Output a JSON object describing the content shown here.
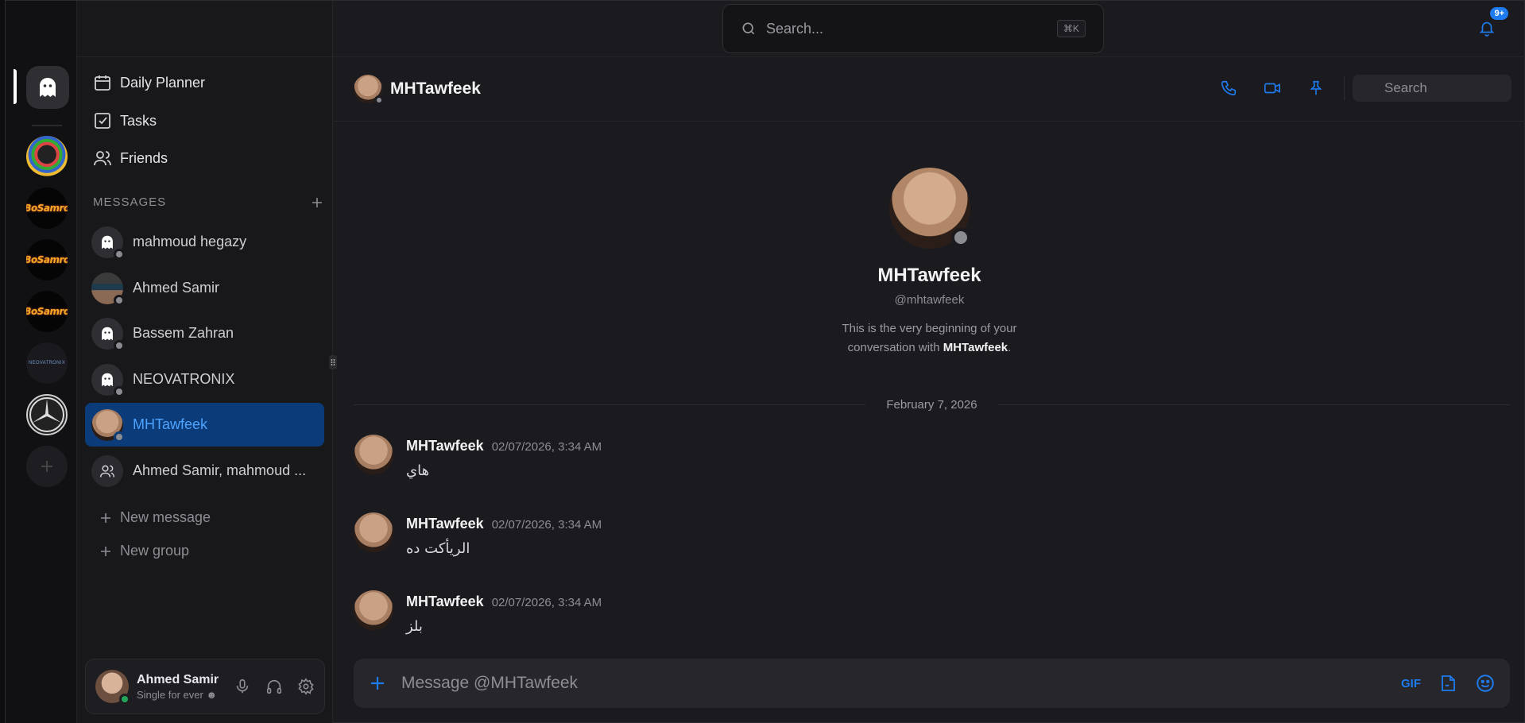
{
  "rail": {
    "servers": [
      "colorful-server",
      "BoSamro",
      "BoSamro",
      "BoSamro",
      "NEOVATRONIX",
      "mercedes-server"
    ],
    "bosamro_text": "BoSamro",
    "neo_text": "NEOVATRONIX"
  },
  "sidebar": {
    "nav": [
      {
        "label": "Daily Planner",
        "icon": "calendar-icon"
      },
      {
        "label": "Tasks",
        "icon": "checkbox-icon"
      },
      {
        "label": "Friends",
        "icon": "users-icon"
      }
    ],
    "messages_header": "MESSAGES",
    "dms": [
      {
        "name": "mahmoud hegazy"
      },
      {
        "name": "Ahmed Samir"
      },
      {
        "name": "Bassem Zahran"
      },
      {
        "name": "NEOVATRONIX"
      },
      {
        "name": "MHTawfeek"
      },
      {
        "name": "Ahmed Samir, mahmoud ..."
      }
    ],
    "new_message": "New message",
    "new_group": "New group"
  },
  "user": {
    "name": "Ahmed Samir",
    "status": "Single for ever ☻"
  },
  "topbar": {
    "search_placeholder": "Search...",
    "shortcut": "⌘K",
    "notifications_badge": "9+"
  },
  "chat": {
    "title": "MHTawfeek",
    "search_placeholder": "Search",
    "intro": {
      "name": "MHTawfeek",
      "handle": "@mhtawfeek",
      "desc_prefix": "This is the very beginning of your conversation with ",
      "desc_name": "MHTawfeek",
      "desc_suffix": "."
    },
    "date_separator": "February 7, 2026",
    "messages": [
      {
        "author": "MHTawfeek",
        "time": "02/07/2026, 3:34 AM",
        "text": "هاي"
      },
      {
        "author": "MHTawfeek",
        "time": "02/07/2026, 3:34 AM",
        "text": "الريأكت ده"
      },
      {
        "author": "MHTawfeek",
        "time": "02/07/2026, 3:34 AM",
        "text": "بلز"
      }
    ],
    "composer_placeholder": "Message @MHTawfeek",
    "gif_label": "GIF"
  },
  "colors": {
    "accent": "#1e7bf0",
    "active_row_bg": "#0b3b78",
    "online": "#23a55a",
    "offline": "#8b8b92"
  }
}
